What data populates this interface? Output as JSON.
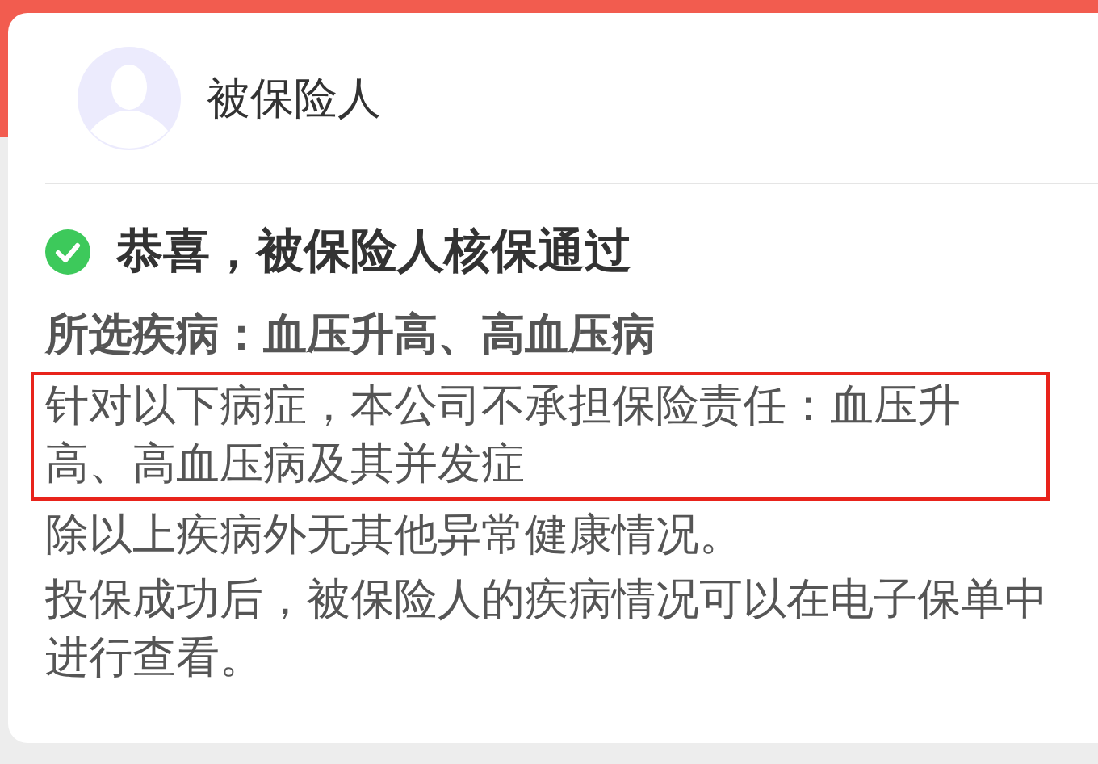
{
  "header": {
    "title": "被保险人"
  },
  "result": {
    "text": "恭喜，被保险人核保通过",
    "passed": true
  },
  "selected_diseases": "所选疾病：血压升高、高血压病",
  "paragraphs": [
    {
      "text": "针对以下病症，本公司不承担保险责任：血压升高、高血压病及其并发症",
      "highlighted": true
    },
    {
      "text": "除以上疾病外无其他异常健康情况。",
      "highlighted": false
    },
    {
      "text": "投保成功后，被保险人的疾病情况可以在电子保单中进行查看。",
      "highlighted": false
    }
  ]
}
